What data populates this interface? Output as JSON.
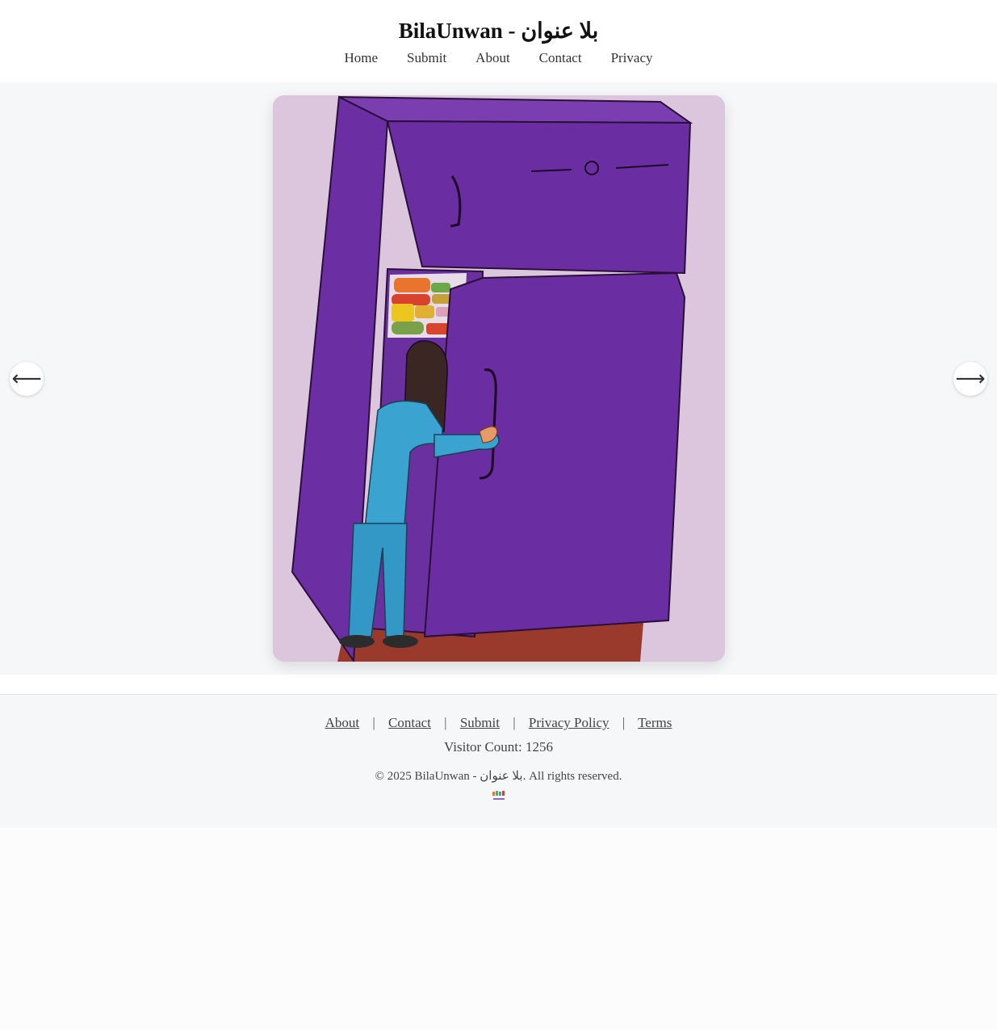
{
  "site": {
    "title": "BilaUnwan - بلا عنوان"
  },
  "nav": {
    "items": [
      {
        "label": "Home"
      },
      {
        "label": "Submit"
      },
      {
        "label": "About"
      },
      {
        "label": "Contact"
      },
      {
        "label": "Privacy"
      }
    ]
  },
  "gallery": {
    "prev_arrow": "⟵",
    "next_arrow": "⟶"
  },
  "footer": {
    "links": [
      {
        "label": "About"
      },
      {
        "label": "Contact"
      },
      {
        "label": "Submit"
      },
      {
        "label": "Privacy Policy"
      },
      {
        "label": "Terms"
      }
    ],
    "separator": "|",
    "visitor_count": "Visitor Count: 1256",
    "copyright": "© 2025 BilaUnwan - بلا عنوان. All rights reserved."
  },
  "colors": {
    "page_bg": "#fcfcfc",
    "section_bg": "#f6f7f9",
    "artwork_paper": "#ddc8df",
    "fridge_purple": "#6a2fa0"
  },
  "icons": {
    "prev": "arrow-left-icon",
    "next": "arrow-right-icon",
    "footer_logo": "bilaunwan-logo-icon"
  }
}
